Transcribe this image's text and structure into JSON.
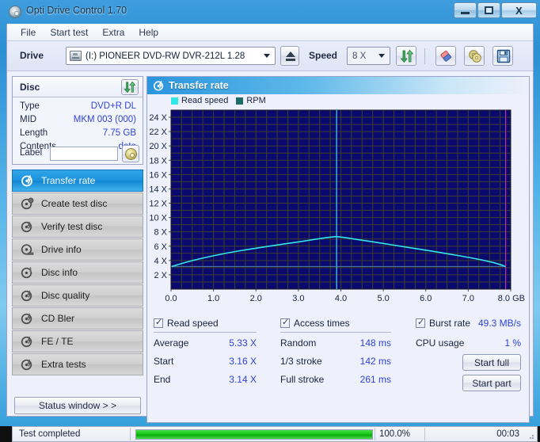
{
  "window": {
    "title": "Opti Drive Control 1.70",
    "icon": "disc-icon",
    "minimize_label": "",
    "maximize_label": "",
    "close_label": "X"
  },
  "menu": {
    "items": [
      {
        "label": "File"
      },
      {
        "label": "Start test"
      },
      {
        "label": "Extra"
      },
      {
        "label": "Help"
      }
    ]
  },
  "toolbar": {
    "drive_label": "Drive",
    "drive_value": "(I:)  PIONEER DVD-RW  DVR-212L 1.28",
    "speed_label": "Speed",
    "speed_value": "8 X",
    "eject_icon": "eject-icon",
    "refresh_icon": "refresh-icon",
    "erase_icon": "eraser-icon",
    "disc_tools_icon": "gold-disc-icon",
    "save_icon": "save-floppy-icon"
  },
  "disc": {
    "header": "Disc",
    "refresh_icon": "refresh-icon",
    "rows": [
      {
        "key": "Type",
        "value": "DVD+R DL"
      },
      {
        "key": "MID",
        "value": "MKM 003 (000)"
      },
      {
        "key": "Length",
        "value": "7.75 GB"
      },
      {
        "key": "Contents",
        "value": "data"
      }
    ],
    "label_key": "Label",
    "label_value": "",
    "label_placeholder": "",
    "label_button_icon": "gold-disc-icon"
  },
  "sidebar": {
    "items": [
      {
        "label": "Transfer rate",
        "icon": "transfer-rate-icon",
        "active": true
      },
      {
        "label": "Create test disc",
        "icon": "create-test-disc-icon",
        "active": false
      },
      {
        "label": "Verify test disc",
        "icon": "verify-test-disc-icon",
        "active": false
      },
      {
        "label": "Drive info",
        "icon": "drive-info-icon",
        "active": false
      },
      {
        "label": "Disc info",
        "icon": "disc-info-icon",
        "active": false
      },
      {
        "label": "Disc quality",
        "icon": "disc-quality-icon",
        "active": false
      },
      {
        "label": "CD Bler",
        "icon": "cd-bler-icon",
        "active": false
      },
      {
        "label": "FE / TE",
        "icon": "fe-te-icon",
        "active": false
      },
      {
        "label": "Extra tests",
        "icon": "extra-tests-icon",
        "active": false
      }
    ],
    "status_window_label": "Status window > >"
  },
  "chart_panel": {
    "header": "Transfer rate",
    "header_icon": "transfer-rate-icon",
    "legend": [
      {
        "label": "Read speed",
        "color": "#31e7e7"
      },
      {
        "label": "RPM",
        "color": "#1d6b6b"
      }
    ]
  },
  "chart_data": {
    "type": "line",
    "title": "Transfer rate",
    "xlabel": "GB",
    "ylabel": "X",
    "xlim": [
      0.0,
      8.0
    ],
    "ylim": [
      0.0,
      25.0
    ],
    "grid": true,
    "legend_position": "top-left",
    "xticks": [
      0.0,
      1.0,
      2.0,
      3.0,
      4.0,
      5.0,
      6.0,
      7.0,
      8.0
    ],
    "xtick_labels": [
      "0.0",
      "1.0",
      "2.0",
      "3.0",
      "4.0",
      "5.0",
      "6.0",
      "7.0",
      "8.0 GB"
    ],
    "yticks": [
      2,
      4,
      6,
      8,
      10,
      12,
      14,
      16,
      18,
      20,
      22,
      24
    ],
    "ytick_labels": [
      "2 X",
      "4 X",
      "6 X",
      "8 X",
      "10 X",
      "12 X",
      "14 X",
      "16 X",
      "18 X",
      "20 X",
      "22 X",
      "24 X"
    ],
    "layer_break_x": 3.9,
    "end_marker_x": 7.88,
    "series": [
      {
        "name": "Read speed",
        "color": "#31e7e7",
        "x": [
          0.02,
          0.15,
          0.3,
          0.5,
          0.75,
          1.0,
          1.3,
          1.6,
          1.9,
          2.2,
          2.5,
          2.8,
          3.1,
          3.4,
          3.65,
          3.85,
          3.9,
          4.1,
          4.35,
          4.65,
          4.95,
          5.25,
          5.55,
          5.85,
          6.15,
          6.45,
          6.75,
          7.05,
          7.35,
          7.6,
          7.8,
          7.88
        ],
        "y": [
          3.16,
          3.4,
          3.66,
          3.98,
          4.34,
          4.66,
          5.02,
          5.34,
          5.62,
          5.9,
          6.16,
          6.42,
          6.68,
          6.96,
          7.18,
          7.32,
          7.34,
          7.2,
          6.96,
          6.7,
          6.42,
          6.14,
          5.86,
          5.58,
          5.3,
          5.0,
          4.7,
          4.38,
          4.04,
          3.7,
          3.34,
          3.14
        ]
      },
      {
        "name": "RPM",
        "color": "#1d6b6b",
        "x": [],
        "y": []
      }
    ]
  },
  "stats": {
    "read_speed": {
      "checkbox_label": "Read speed",
      "checked": true,
      "rows": [
        {
          "key": "Average",
          "value": "5.33 X"
        },
        {
          "key": "Start",
          "value": "3.16 X"
        },
        {
          "key": "End",
          "value": "3.14 X"
        }
      ]
    },
    "access_times": {
      "checkbox_label": "Access times",
      "checked": true,
      "rows": [
        {
          "key": "Random",
          "value": "148 ms"
        },
        {
          "key": "1/3 stroke",
          "value": "142 ms"
        },
        {
          "key": "Full stroke",
          "value": "261 ms"
        }
      ]
    },
    "burst_rate": {
      "checkbox_label": "Burst rate",
      "checked": true,
      "value": "49.3 MB/s",
      "cpu_key": "CPU usage",
      "cpu_value": "1 %"
    },
    "buttons": [
      {
        "label": "Start full"
      },
      {
        "label": "Start part"
      }
    ]
  },
  "statusbar": {
    "message": "Test completed",
    "progress_percent": 100.0,
    "progress_label": "100.0%",
    "elapsed": "00:03"
  }
}
